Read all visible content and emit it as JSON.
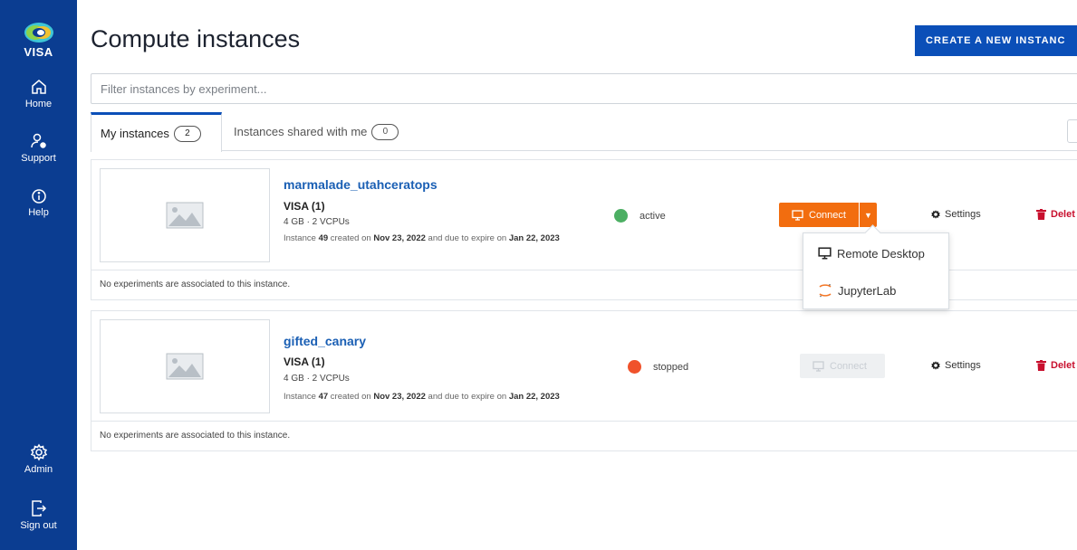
{
  "sidebar": {
    "brand": "VISA",
    "items": [
      {
        "label": "Home",
        "icon": "home-icon"
      },
      {
        "label": "Support",
        "icon": "support-icon"
      },
      {
        "label": "Help",
        "icon": "info-icon"
      },
      {
        "label": "Admin",
        "icon": "gear-icon"
      },
      {
        "label": "Sign out",
        "icon": "sign-out-icon"
      }
    ]
  },
  "header": {
    "title": "Compute instances",
    "create_label": "CREATE A NEW INSTANC"
  },
  "filter": {
    "placeholder": "Filter instances by experiment..."
  },
  "tabs": [
    {
      "label": "My instances",
      "count": "2",
      "active": true
    },
    {
      "label": "Instances shared with me",
      "count": "0",
      "active": false
    }
  ],
  "instances": [
    {
      "name": "marmalade_utahceratops",
      "group": "VISA (1)",
      "spec": "4 GB · 2 VCPUs",
      "created_prefix": "Instance",
      "id": "49",
      "created_mid": "created on",
      "created_date": "Nov 23, 2022",
      "expire_mid": "and due to expire on",
      "expire_date": "Jan 22, 2023",
      "status": "active",
      "status_color": "#4caf63",
      "connect_label": "Connect",
      "settings_label": "Settings",
      "delete_label": "Delet",
      "footer": "No experiments are associated to this instance."
    },
    {
      "name": "gifted_canary",
      "group": "VISA (1)",
      "spec": "4 GB · 2 VCPUs",
      "created_prefix": "Instance",
      "id": "47",
      "created_mid": "created on",
      "created_date": "Nov 23, 2022",
      "expire_mid": "and due to expire on",
      "expire_date": "Jan 22, 2023",
      "status": "stopped",
      "status_color": "#f0522b",
      "connect_label": "Connect",
      "settings_label": "Settings",
      "delete_label": "Delet",
      "footer": "No experiments are associated to this instance."
    }
  ],
  "connect_menu": {
    "items": [
      {
        "label": "Remote Desktop",
        "icon": "monitor-icon"
      },
      {
        "label": "JupyterLab",
        "icon": "jupyter-icon"
      }
    ]
  },
  "colors": {
    "sidebar": "#0b3d91",
    "accent": "#0b4fb8",
    "connect": "#f26d0f",
    "delete": "#c8102e",
    "link": "#1a5fb4"
  }
}
